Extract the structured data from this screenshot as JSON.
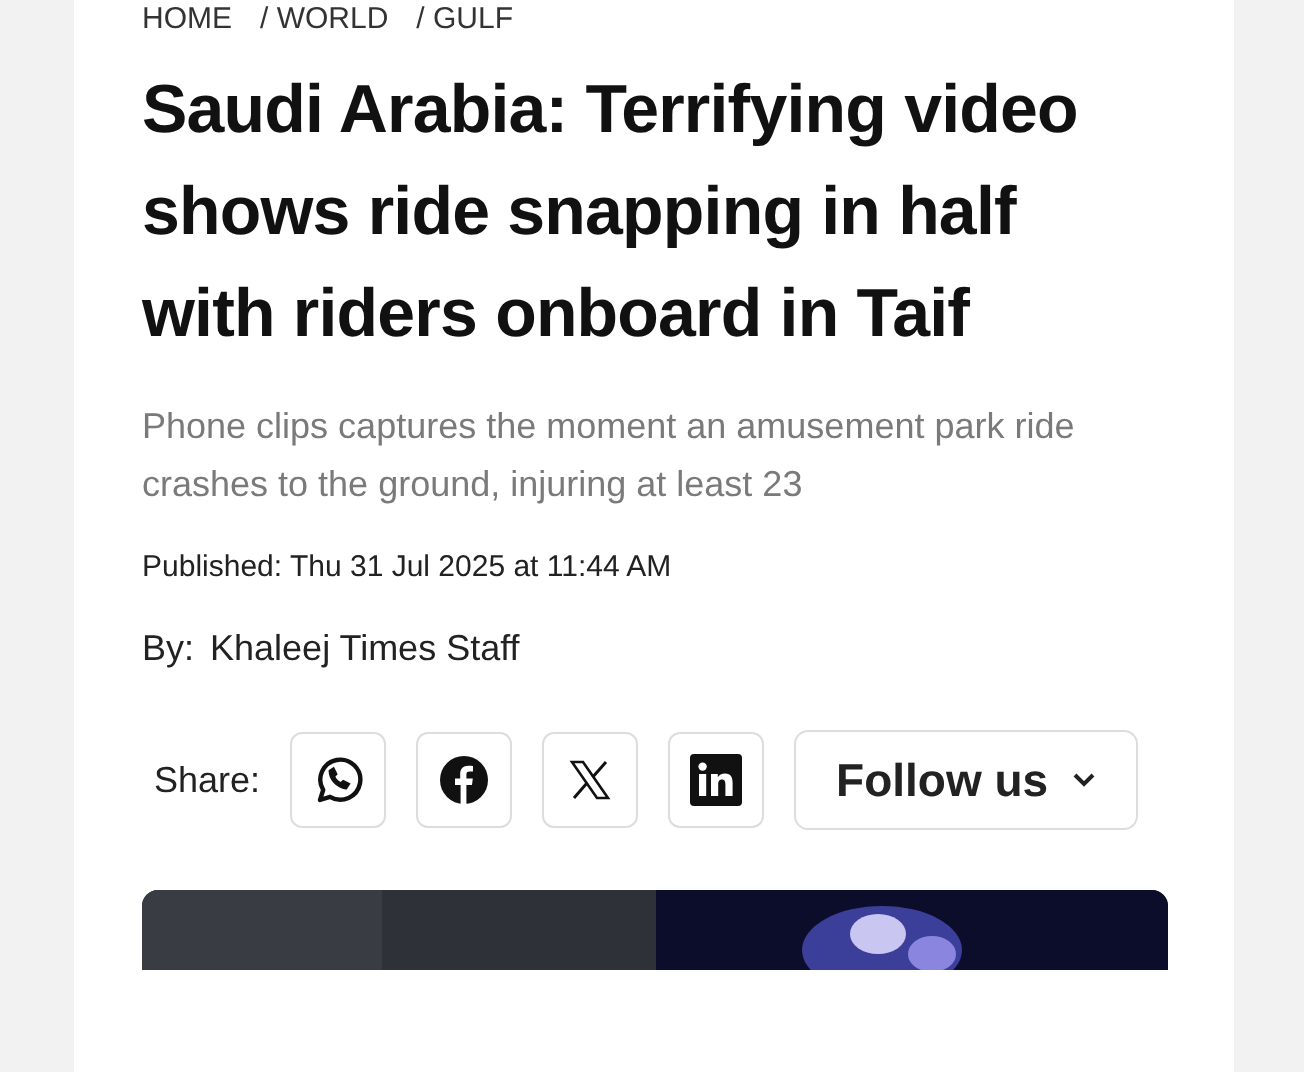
{
  "breadcrumb": [
    "HOME",
    "/ WORLD",
    "/ GULF"
  ],
  "headline": "Saudi Arabia: Terrifying video shows ride snapping in half with riders onboard in Taif",
  "summary": "Phone clips captures the moment an amusement park ride crashes to the ground, injuring at least 23",
  "published": {
    "label": "Published:",
    "value": "Thu 31 Jul 2025 at 11:44 AM"
  },
  "byline": {
    "label": "By:",
    "author": "Khaleej Times Staff"
  },
  "share": {
    "label": "Share:",
    "buttons": [
      {
        "kind": "whatsapp"
      },
      {
        "kind": "facebook"
      },
      {
        "kind": "x"
      },
      {
        "kind": "linkedin"
      }
    ],
    "follow": "Follow us"
  },
  "media": {
    "kind": "picture"
  }
}
